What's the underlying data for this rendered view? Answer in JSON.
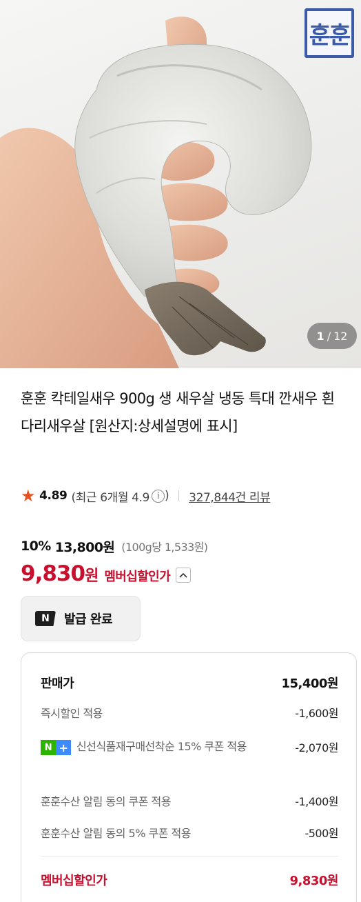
{
  "hero": {
    "brand_logo_text": "훈훈",
    "counter_current": "1",
    "counter_total": "12"
  },
  "product": {
    "title": "훈훈 칵테일새우 900g 생 새우살 냉동 특대 깐새우 흰다리새우살 [원산지:상세설명에 표시]"
  },
  "rating": {
    "score": "4.89",
    "recent_label": "(최근 6개월 4.9",
    "recent_close": ")",
    "review_count": "327,844건 리뷰"
  },
  "price": {
    "discount_rate": "10%",
    "original_price": "13,800원",
    "unit_price": "(100g당 1,533원)",
    "member_price": "9,830",
    "member_won": "원",
    "member_label": "멤버십할인가"
  },
  "coupon": {
    "icon_text": "N",
    "label": "발급 완료"
  },
  "breakdown": {
    "sale_label": "판매가",
    "sale_value": "15,400원",
    "items": [
      {
        "label": "즉시할인 적용",
        "value": "-1,600원"
      },
      {
        "label": "신선식품재구매선착순 15% 쿠폰 적용",
        "value": "-2,070원"
      },
      {
        "label": "훈훈수산 알림 동의 쿠폰 적용",
        "value": "-1,400원"
      },
      {
        "label": "훈훈수산 알림 동의 5% 쿠폰 적용",
        "value": "-500원"
      }
    ],
    "total_label": "멤버십할인가",
    "total_value": "9,830원"
  },
  "colors": {
    "accent_red": "#c8102e",
    "star_orange": "#e8501e",
    "naver_green": "#2db400",
    "naver_plus_blue": "#3d8bff",
    "brand_blue": "#3b5aa8"
  },
  "icons": [
    "star-icon",
    "info-icon",
    "chevron-up-icon",
    "naver-n-icon",
    "naver-plus-badge-icon"
  ]
}
